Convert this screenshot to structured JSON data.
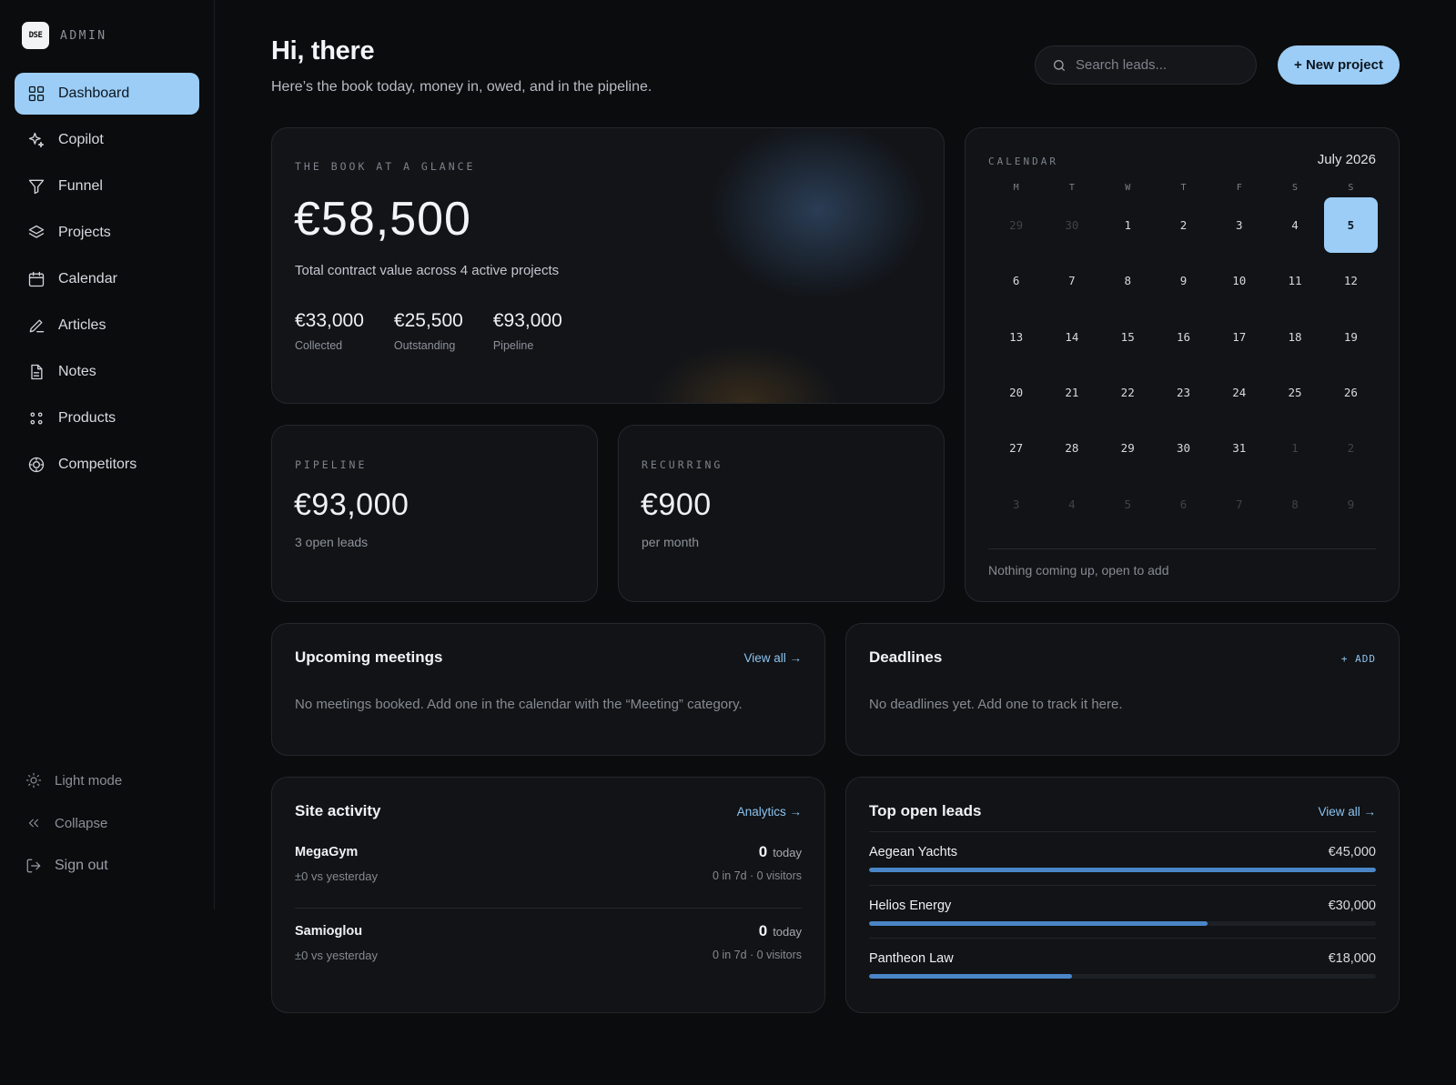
{
  "brand": {
    "logo_text": "DSE",
    "label": "ADMIN"
  },
  "nav": [
    {
      "label": "Dashboard",
      "icon": "grid-icon",
      "active": true
    },
    {
      "label": "Copilot",
      "icon": "sparkle-icon"
    },
    {
      "label": "Funnel",
      "icon": "funnel-icon"
    },
    {
      "label": "Projects",
      "icon": "layers-icon"
    },
    {
      "label": "Calendar",
      "icon": "calendar-icon"
    },
    {
      "label": "Articles",
      "icon": "pen-icon"
    },
    {
      "label": "Notes",
      "icon": "document-icon"
    },
    {
      "label": "Products",
      "icon": "dots-grid-icon"
    },
    {
      "label": "Competitors",
      "icon": "target-icon"
    }
  ],
  "bottom_nav": {
    "light_mode": "Light mode",
    "collapse": "Collapse",
    "sign_out": "Sign out"
  },
  "header": {
    "greeting": "Hi, there",
    "subtitle": "Here’s the book today, money in, owed, and in the pipeline.",
    "search_placeholder": "Search leads...",
    "new_project": "+ New project"
  },
  "book": {
    "eyebrow": "THE BOOK AT A GLANCE",
    "total": "€58,500",
    "description": "Total contract value across 4 active projects",
    "stats": [
      {
        "value": "€33,000",
        "label": "Collected"
      },
      {
        "value": "€25,500",
        "label": "Outstanding"
      },
      {
        "value": "€93,000",
        "label": "Pipeline"
      }
    ]
  },
  "pipeline": {
    "eyebrow": "PIPELINE",
    "value": "€93,000",
    "sub": "3 open leads"
  },
  "recurring": {
    "eyebrow": "RECURRING",
    "value": "€900",
    "sub": "per month"
  },
  "calendar": {
    "eyebrow": "CALENDAR",
    "month": "July 2026",
    "weekdays": [
      "M",
      "T",
      "W",
      "T",
      "F",
      "S",
      "S"
    ],
    "days": [
      {
        "d": "29",
        "dim": true
      },
      {
        "d": "30",
        "dim": true
      },
      {
        "d": "1"
      },
      {
        "d": "2"
      },
      {
        "d": "3"
      },
      {
        "d": "4"
      },
      {
        "d": "5",
        "today": true
      },
      {
        "d": "6"
      },
      {
        "d": "7"
      },
      {
        "d": "8"
      },
      {
        "d": "9"
      },
      {
        "d": "10"
      },
      {
        "d": "11"
      },
      {
        "d": "12"
      },
      {
        "d": "13"
      },
      {
        "d": "14"
      },
      {
        "d": "15"
      },
      {
        "d": "16"
      },
      {
        "d": "17"
      },
      {
        "d": "18"
      },
      {
        "d": "19"
      },
      {
        "d": "20"
      },
      {
        "d": "21"
      },
      {
        "d": "22"
      },
      {
        "d": "23"
      },
      {
        "d": "24"
      },
      {
        "d": "25"
      },
      {
        "d": "26"
      },
      {
        "d": "27"
      },
      {
        "d": "28"
      },
      {
        "d": "29"
      },
      {
        "d": "30"
      },
      {
        "d": "31"
      },
      {
        "d": "1",
        "dim": true
      },
      {
        "d": "2",
        "dim": true
      },
      {
        "d": "3",
        "dim": true
      },
      {
        "d": "4",
        "dim": true
      },
      {
        "d": "5",
        "dim": true
      },
      {
        "d": "6",
        "dim": true
      },
      {
        "d": "7",
        "dim": true
      },
      {
        "d": "8",
        "dim": true
      },
      {
        "d": "9",
        "dim": true
      }
    ],
    "empty": "Nothing coming up, open to add"
  },
  "meetings": {
    "title": "Upcoming meetings",
    "link": "View all →",
    "empty": "No meetings booked. Add one in the calendar with the “Meeting” category."
  },
  "deadlines": {
    "title": "Deadlines",
    "link": "+ ADD",
    "empty": "No deadlines yet. Add one to track it here."
  },
  "site_activity": {
    "title": "Site activity",
    "link": "Analytics →",
    "rows": [
      {
        "name": "MegaGym",
        "today_value": "0",
        "today_label": "today",
        "delta": "±0 vs yesterday",
        "meta": "0 in 7d · 0 visitors"
      },
      {
        "name": "Samioglou",
        "today_value": "0",
        "today_label": "today",
        "delta": "±0 vs yesterday",
        "meta": "0 in 7d · 0 visitors"
      }
    ]
  },
  "top_leads": {
    "title": "Top open leads",
    "link": "View all →",
    "rows": [
      {
        "name": "Aegean Yachts",
        "value": "€45,000",
        "fraction": 1.0
      },
      {
        "name": "Helios Energy",
        "value": "€30,000",
        "fraction": 0.667
      },
      {
        "name": "Pantheon Law",
        "value": "€18,000",
        "fraction": 0.4
      }
    ]
  },
  "colors": {
    "accent": "#9ccdf6",
    "bar": "#4a86c7",
    "background": "#0b0c0e",
    "card": "#111316"
  }
}
